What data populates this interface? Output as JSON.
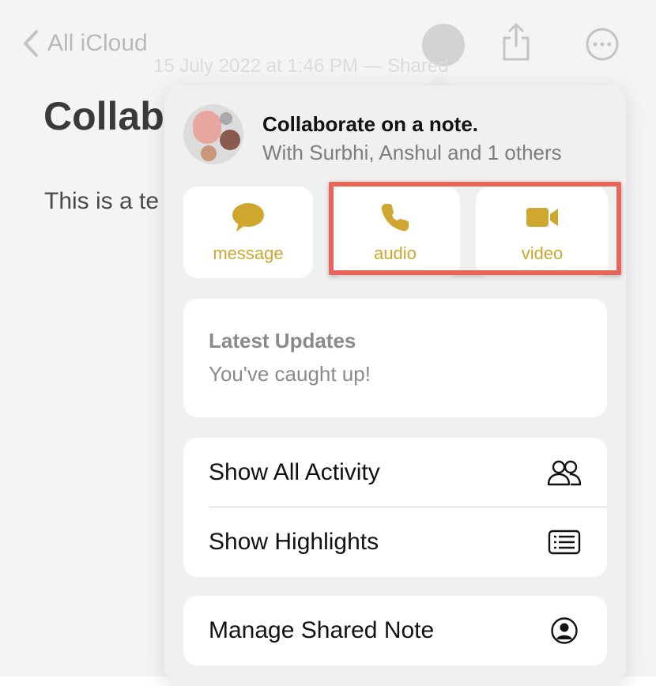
{
  "nav": {
    "back_label": "All iCloud"
  },
  "note": {
    "date_text": "15 July 2022 at 1:46 PM — Shared",
    "title": "Collab",
    "body": "This is a te"
  },
  "popover": {
    "header": {
      "title": "Collaborate on a note.",
      "subtitle": "With Surbhi, Anshul and 1 others"
    },
    "actions": [
      {
        "label": "message",
        "icon": "message-bubble-icon"
      },
      {
        "label": "audio",
        "icon": "phone-icon"
      },
      {
        "label": "video",
        "icon": "video-camera-icon"
      }
    ],
    "updates": {
      "title": "Latest Updates",
      "subtitle": "You've caught up!"
    },
    "list": [
      {
        "label": "Show All Activity",
        "icon": "people-icon"
      },
      {
        "label": "Show Highlights",
        "icon": "list-icon"
      }
    ],
    "manage": {
      "label": "Manage Shared Note",
      "icon": "person-circle-icon"
    }
  },
  "colors": {
    "accent": "#cfa62e",
    "highlight": "#e8655a"
  }
}
